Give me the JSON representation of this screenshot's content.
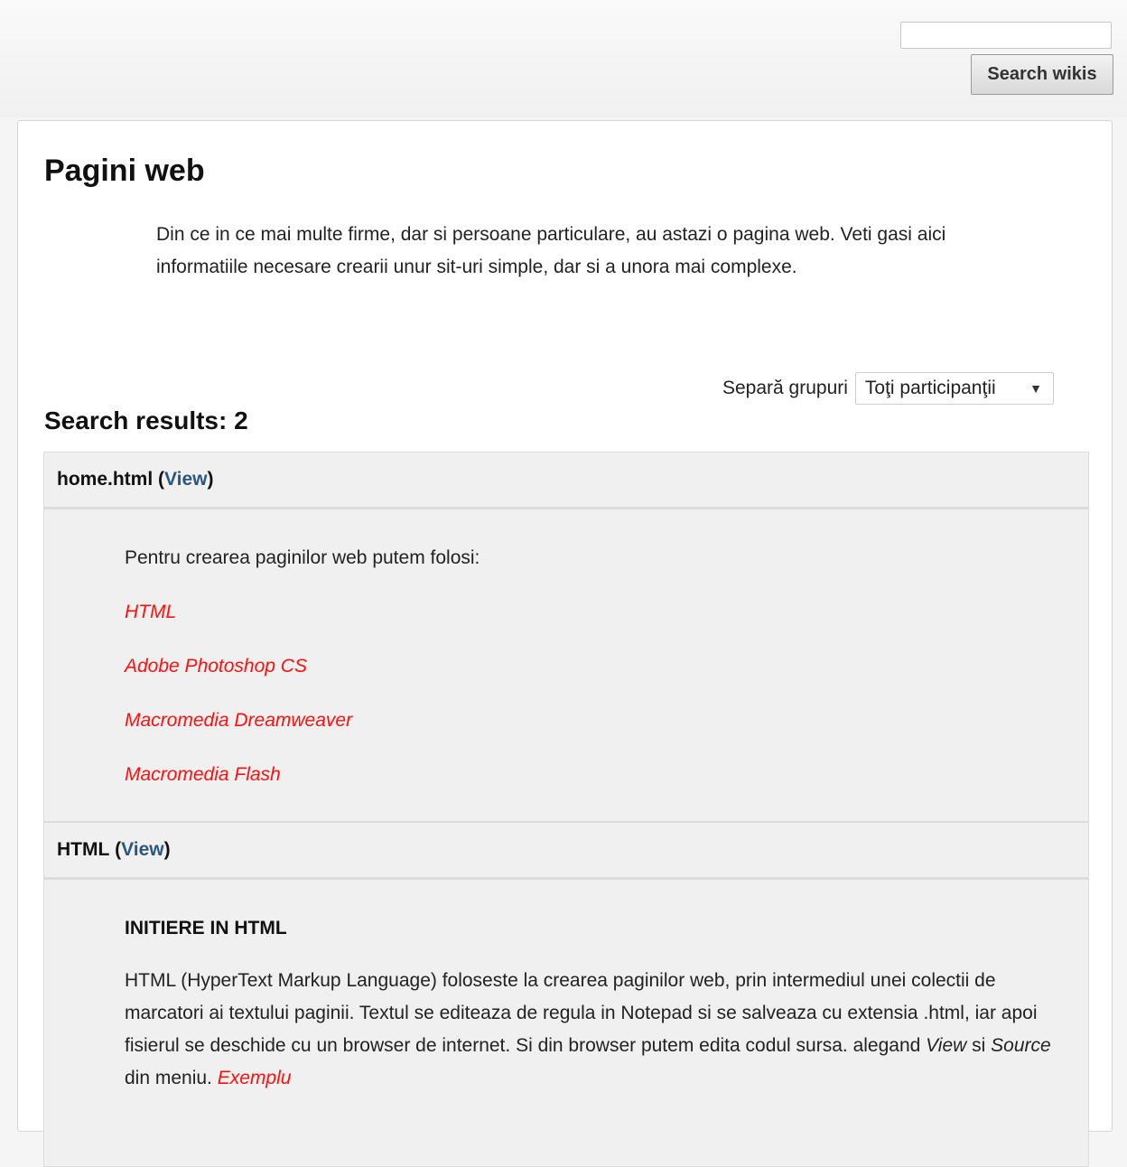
{
  "search": {
    "input_value": "",
    "button_label": "Search wikis"
  },
  "page": {
    "title": "Pagini web",
    "intro": "Din ce in ce mai multe firme, dar si persoane particulare, au astazi o pagina web. Veti gasi aici informatiile necesare crearii unur sit-uri simple, dar si a unora mai complexe."
  },
  "groups": {
    "label": "Separă grupuri",
    "selected": "Toţi participanţii"
  },
  "results": {
    "heading": "Search results: 2",
    "items": [
      {
        "title": "home.html",
        "view_label": "View",
        "intro": "Pentru crearea paginilor web putem folosi:",
        "links": [
          "HTML",
          "Adobe Photoshop CS",
          "Macromedia Dreamweaver",
          "Macromedia Flash"
        ]
      },
      {
        "title": "HTML",
        "view_label": "View",
        "subheading": "INITIERE IN HTML",
        "text_before": "HTML (HyperText Markup Language) foloseste la crearea paginilor web, prin intermediul unei colectii de marcatori ai textului paginii. Textul se editeaza de regula in Notepad si se salveaza cu extensia .html, iar apoi fisierul se deschide cu un browser de internet. Si din browser putem edita codul sursa. alegand ",
        "em_view": "View",
        "text_si": " si ",
        "em_source": "Source",
        "text_after": " din meniu. ",
        "link_exemplu": "Exemplu"
      }
    ]
  },
  "colors": {
    "link_red": "#ff1010",
    "link_blue": "#2a5780",
    "panel_bg": "#f0f0f0"
  }
}
